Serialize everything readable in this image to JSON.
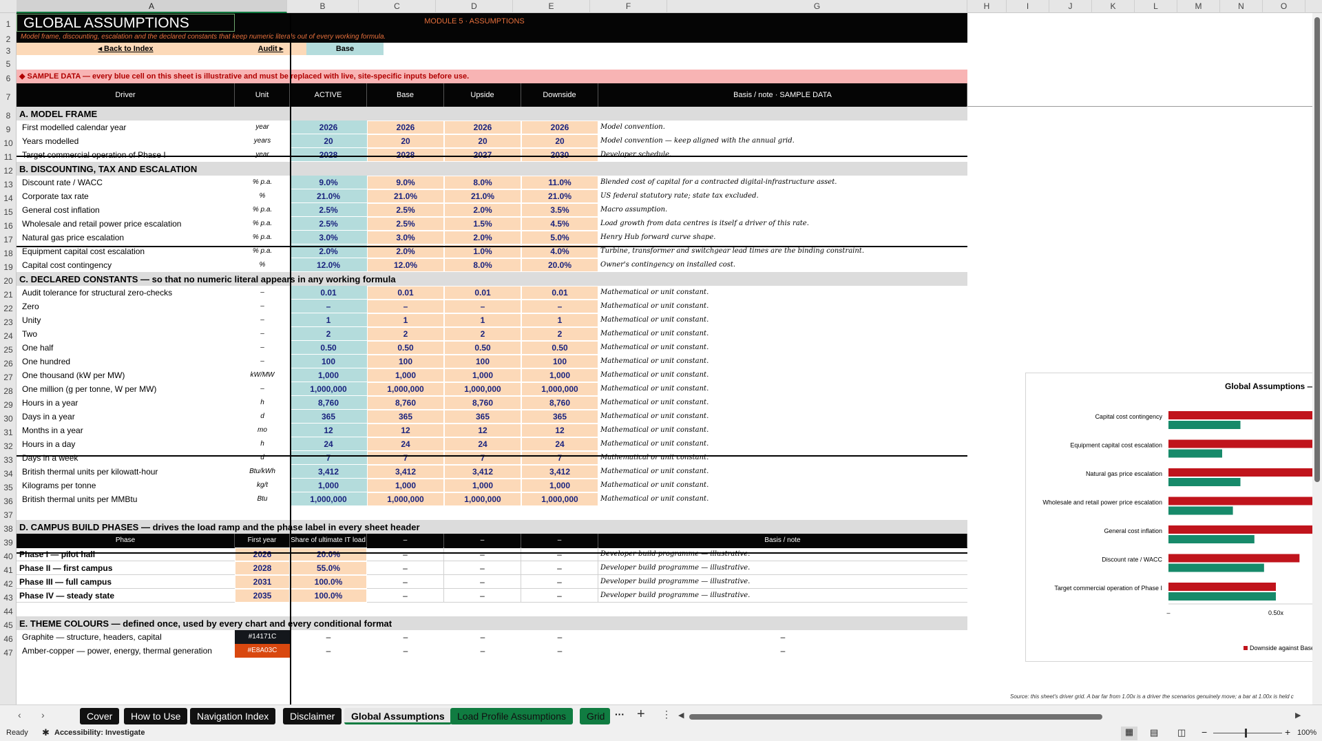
{
  "columns": [
    "A",
    "B",
    "C",
    "D",
    "E",
    "F",
    "G",
    "H",
    "I",
    "J",
    "K",
    "L",
    "M",
    "N",
    "O"
  ],
  "rows": [
    "1",
    "2",
    "3",
    "5",
    "6",
    "7",
    "8",
    "9",
    "10",
    "11",
    "12",
    "13",
    "14",
    "15",
    "16",
    "17",
    "18",
    "19",
    "20",
    "21",
    "22",
    "23",
    "24",
    "25",
    "26",
    "27",
    "28",
    "29",
    "30",
    "31",
    "32",
    "33",
    "34",
    "35",
    "36",
    "37",
    "38",
    "39",
    "40",
    "41",
    "42",
    "43",
    "44",
    "45",
    "46",
    "47"
  ],
  "header": {
    "title": "GLOBAL ASSUMPTIONS",
    "module": "MODULE 5  ·  ASSUMPTIONS",
    "subtitle": "Model frame, discounting, escalation and the declared constants that keep numeric literals out of every working formula.",
    "back_link": "◂  Back to Index",
    "audit_link": "Audit  ▸",
    "scenario": "Base",
    "sample_banner": "◆  SAMPLE DATA — every blue cell on this sheet is illustrative and must be replaced with live, site-specific inputs before use."
  },
  "table_header": [
    "Driver",
    "Unit",
    "ACTIVE",
    "Base",
    "Upside",
    "Downside",
    "Basis / note  ·  SAMPLE DATA"
  ],
  "sections": {
    "a": "A.  MODEL FRAME",
    "b": "B.  DISCOUNTING, TAX AND ESCALATION",
    "c": "C.  DECLARED CONSTANTS  —  so that no numeric literal appears in any working formula",
    "d": "D.  CAMPUS BUILD PHASES  —  drives the load ramp and the phase label in every sheet header",
    "e": "E.  THEME COLOURS  —  defined once, used by every chart and every conditional format"
  },
  "drivers": [
    {
      "row": "9",
      "name": "First modelled calendar year",
      "unit": "year",
      "active": "2026",
      "base": "2026",
      "up": "2026",
      "down": "2026",
      "note": "Model convention."
    },
    {
      "row": "10",
      "name": "Years modelled",
      "unit": "years",
      "active": "20",
      "base": "20",
      "up": "20",
      "down": "20",
      "note": "Model convention — keep aligned with the annual grid."
    },
    {
      "row": "11",
      "name": "Target commercial operation of Phase I",
      "unit": "year",
      "active": "2028",
      "base": "2028",
      "up": "2027",
      "down": "2030",
      "note": "Developer schedule."
    },
    {
      "row": "13",
      "name": "Discount rate / WACC",
      "unit": "% p.a.",
      "active": "9.0%",
      "base": "9.0%",
      "up": "8.0%",
      "down": "11.0%",
      "note": "Blended cost of capital for a contracted digital-infrastructure asset."
    },
    {
      "row": "14",
      "name": "Corporate tax rate",
      "unit": "%",
      "active": "21.0%",
      "base": "21.0%",
      "up": "21.0%",
      "down": "21.0%",
      "note": "US federal statutory rate; state tax excluded."
    },
    {
      "row": "15",
      "name": "General cost inflation",
      "unit": "% p.a.",
      "active": "2.5%",
      "base": "2.5%",
      "up": "2.0%",
      "down": "3.5%",
      "note": "Macro assumption."
    },
    {
      "row": "16",
      "name": "Wholesale and retail power price escalation",
      "unit": "% p.a.",
      "active": "2.5%",
      "base": "2.5%",
      "up": "1.5%",
      "down": "4.5%",
      "note": "Load growth from data centres is itself a driver of this rate."
    },
    {
      "row": "17",
      "name": "Natural gas price escalation",
      "unit": "% p.a.",
      "active": "3.0%",
      "base": "3.0%",
      "up": "2.0%",
      "down": "5.0%",
      "note": "Henry Hub forward curve shape."
    },
    {
      "row": "18",
      "name": "Equipment capital cost escalation",
      "unit": "% p.a.",
      "active": "2.0%",
      "base": "2.0%",
      "up": "1.0%",
      "down": "4.0%",
      "note": "Turbine, transformer and switchgear lead times are the binding constraint."
    },
    {
      "row": "19",
      "name": "Capital cost contingency",
      "unit": "%",
      "active": "12.0%",
      "base": "12.0%",
      "up": "8.0%",
      "down": "20.0%",
      "note": "Owner's contingency on installed cost."
    },
    {
      "row": "21",
      "name": "Audit tolerance for structural zero-checks",
      "unit": "–",
      "active": "0.01",
      "base": "0.01",
      "up": "0.01",
      "down": "0.01",
      "note": "Mathematical or unit constant."
    },
    {
      "row": "22",
      "name": "Zero",
      "unit": "–",
      "active": "–",
      "base": "–",
      "up": "–",
      "down": "–",
      "note": "Mathematical or unit constant."
    },
    {
      "row": "23",
      "name": "Unity",
      "unit": "–",
      "active": "1",
      "base": "1",
      "up": "1",
      "down": "1",
      "note": "Mathematical or unit constant."
    },
    {
      "row": "24",
      "name": "Two",
      "unit": "–",
      "active": "2",
      "base": "2",
      "up": "2",
      "down": "2",
      "note": "Mathematical or unit constant."
    },
    {
      "row": "25",
      "name": "One half",
      "unit": "–",
      "active": "0.50",
      "base": "0.50",
      "up": "0.50",
      "down": "0.50",
      "note": "Mathematical or unit constant."
    },
    {
      "row": "26",
      "name": "One hundred",
      "unit": "–",
      "active": "100",
      "base": "100",
      "up": "100",
      "down": "100",
      "note": "Mathematical or unit constant."
    },
    {
      "row": "27",
      "name": "One thousand (kW per MW)",
      "unit": "kW/MW",
      "active": "1,000",
      "base": "1,000",
      "up": "1,000",
      "down": "1,000",
      "note": "Mathematical or unit constant."
    },
    {
      "row": "28",
      "name": "One million (g per tonne, W per MW)",
      "unit": "–",
      "active": "1,000,000",
      "base": "1,000,000",
      "up": "1,000,000",
      "down": "1,000,000",
      "note": "Mathematical or unit constant."
    },
    {
      "row": "29",
      "name": "Hours in a year",
      "unit": "h",
      "active": "8,760",
      "base": "8,760",
      "up": "8,760",
      "down": "8,760",
      "note": "Mathematical or unit constant."
    },
    {
      "row": "30",
      "name": "Days in a year",
      "unit": "d",
      "active": "365",
      "base": "365",
      "up": "365",
      "down": "365",
      "note": "Mathematical or unit constant."
    },
    {
      "row": "31",
      "name": "Months in a year",
      "unit": "mo",
      "active": "12",
      "base": "12",
      "up": "12",
      "down": "12",
      "note": "Mathematical or unit constant."
    },
    {
      "row": "32",
      "name": "Hours in a day",
      "unit": "h",
      "active": "24",
      "base": "24",
      "up": "24",
      "down": "24",
      "note": "Mathematical or unit constant."
    },
    {
      "row": "33",
      "name": "Days in a week",
      "unit": "d",
      "active": "7",
      "base": "7",
      "up": "7",
      "down": "7",
      "note": "Mathematical or unit constant."
    },
    {
      "row": "34",
      "name": "British thermal units per kilowatt-hour",
      "unit": "Btu/kWh",
      "active": "3,412",
      "base": "3,412",
      "up": "3,412",
      "down": "3,412",
      "note": "Mathematical or unit constant."
    },
    {
      "row": "35",
      "name": "Kilograms per tonne",
      "unit": "kg/t",
      "active": "1,000",
      "base": "1,000",
      "up": "1,000",
      "down": "1,000",
      "note": "Mathematical or unit constant."
    },
    {
      "row": "36",
      "name": "British thermal units per MMBtu",
      "unit": "Btu",
      "active": "1,000,000",
      "base": "1,000,000",
      "up": "1,000,000",
      "down": "1,000,000",
      "note": "Mathematical or unit constant."
    }
  ],
  "phase_header": [
    "Phase",
    "First year",
    "Share of ultimate IT load",
    "–",
    "–",
    "–",
    "Basis / note"
  ],
  "phases": [
    {
      "name": "Phase I — pilot hall",
      "year": "2026",
      "share": "20.0%",
      "note": "Developer build programme — illustrative."
    },
    {
      "name": "Phase II — first campus",
      "year": "2028",
      "share": "55.0%",
      "note": "Developer build programme — illustrative."
    },
    {
      "name": "Phase III — full campus",
      "year": "2031",
      "share": "100.0%",
      "note": "Developer build programme — illustrative."
    },
    {
      "name": "Phase IV — steady state",
      "year": "2035",
      "share": "100.0%",
      "note": "Developer build programme — illustrative."
    }
  ],
  "dash": "–",
  "colours": [
    {
      "name": "Graphite — structure, headers, capital",
      "hex": "#14171C",
      "swatch": "#14171c"
    },
    {
      "name": "Amber-copper — power, energy, thermal generation",
      "hex": "#E8A03C",
      "swatch": "#d9480f"
    }
  ],
  "chart_data": {
    "type": "bar",
    "title": "Global Assumptions — Sc",
    "categories": [
      "Capital cost contingency",
      "Equipment capital cost escalation",
      "Natural gas price escalation",
      "Wholesale and retail power price escalation",
      "General cost inflation",
      "Discount rate / WACC",
      "Target commercial operation of Phase I"
    ],
    "series": [
      {
        "name": "Downside against Base",
        "color": "#c0141c",
        "values": [
          1.67,
          2.0,
          1.67,
          1.8,
          1.4,
          1.22,
          1.0
        ]
      },
      {
        "name": "",
        "color": "#178a6a",
        "values": [
          0.67,
          0.5,
          0.67,
          0.6,
          0.8,
          0.89,
          1.0
        ]
      }
    ],
    "x_tick_labels": [
      "–",
      "0.50x"
    ],
    "legend_label": "Downside against Base",
    "source_note": "Source: this sheet's driver grid. A bar far from 1.00x is a driver the scenarios genuinely move; a bar at 1.00x is held c"
  },
  "tabs": [
    "Cover",
    "How to Use",
    "Navigation Index",
    "Disclaimer",
    "Global Assumptions",
    "Load Profile Assumptions",
    "Grid A"
  ],
  "tab_more": "···",
  "tab_add": "+",
  "tab_menu": "⋮",
  "status": {
    "ready": "Ready",
    "accessibility": "Accessibility: Investigate",
    "zoom": "100%"
  }
}
